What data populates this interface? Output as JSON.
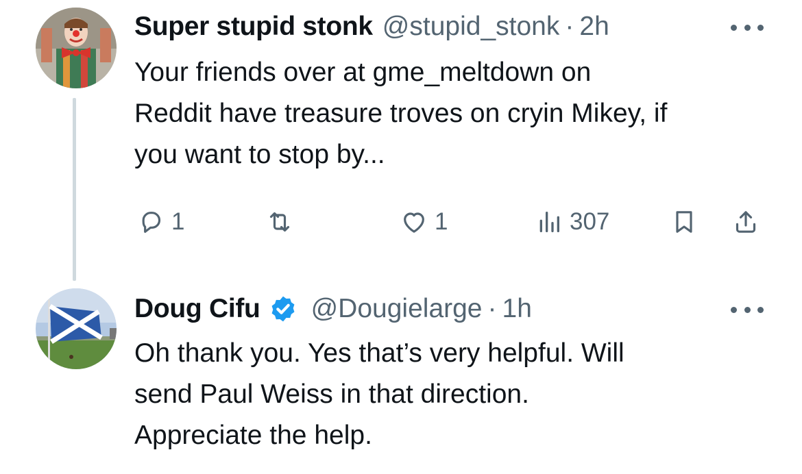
{
  "tweet1": {
    "display_name": "Super stupid stonk",
    "handle": "@stupid_stonk",
    "separator": "·",
    "time": "2h",
    "text_lines": [
      "Your friends over at gme_meltdown on",
      "Reddit have treasure troves on cryin Mikey, if",
      "you want to stop by..."
    ],
    "actions": {
      "replies": "1",
      "likes": "1",
      "views": "307"
    },
    "icons": {
      "more": "more-icon",
      "reply": "reply-icon",
      "retweet": "retweet-icon",
      "like": "heart-icon",
      "views": "views-icon",
      "bookmark": "bookmark-icon",
      "share": "share-icon"
    }
  },
  "tweet2": {
    "display_name": "Doug Cifu",
    "verified_icon": "verified-badge-icon",
    "handle": "@Dougielarge",
    "separator": "·",
    "time": "1h",
    "text_lines": [
      "Oh thank you.  Yes that’s very helpful.  Will",
      "send Paul Weiss in that direction.",
      "Appreciate the help."
    ]
  },
  "colors": {
    "text": "#0f1419",
    "secondary": "#536471",
    "verified": "#1d9bf0",
    "thread_line": "#cfd9de"
  }
}
